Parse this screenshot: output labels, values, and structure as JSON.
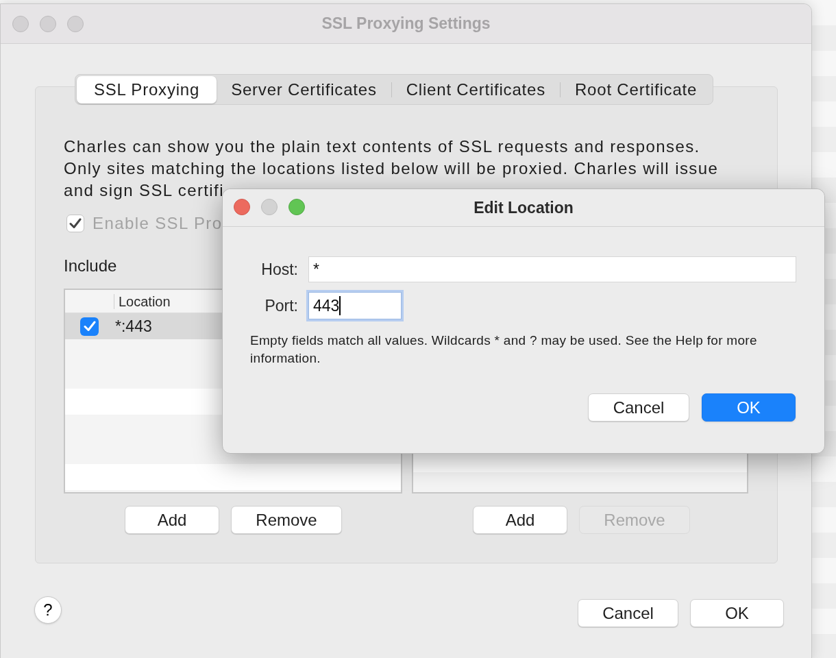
{
  "window": {
    "title": "SSL Proxying Settings"
  },
  "tabs": [
    {
      "label": "SSL Proxying",
      "selected": true
    },
    {
      "label": "Server Certificates",
      "selected": false
    },
    {
      "label": "Client Certificates",
      "selected": false
    },
    {
      "label": "Root Certificate",
      "selected": false
    }
  ],
  "description_lines": [
    "Charles can show you the plain text contents of SSL requests and responses.",
    "Only sites matching the locations listed below will be proxied. Charles will issue",
    "and sign SSL certifi"
  ],
  "enable_checkbox": {
    "label": "Enable SSL Pro",
    "checked": true,
    "disabled": true
  },
  "include": {
    "title": "Include",
    "columns": [
      "Location"
    ],
    "rows": [
      {
        "enabled": true,
        "location": "*:443",
        "selected": true
      }
    ],
    "buttons": [
      {
        "label": "Add",
        "disabled": false
      },
      {
        "label": "Remove",
        "disabled": false
      }
    ]
  },
  "exclude": {
    "buttons": [
      {
        "label": "Add",
        "disabled": false
      },
      {
        "label": "Remove",
        "disabled": true
      }
    ]
  },
  "help_button": "?",
  "buttons": [
    {
      "label": "Cancel",
      "default": false
    },
    {
      "label": "OK",
      "default": false
    }
  ],
  "dialog": {
    "title": "Edit Location",
    "fields": [
      {
        "label": "Host:",
        "value": "*",
        "focused": false,
        "kind": "wide"
      },
      {
        "label": "Port:",
        "value": "443",
        "focused": true,
        "kind": "short"
      }
    ],
    "hint": "Empty fields match all values. Wildcards * and ? may be used. See the Help for more information.",
    "buttons": [
      {
        "label": "Cancel",
        "default": false
      },
      {
        "label": "OK",
        "default": true
      }
    ]
  }
}
